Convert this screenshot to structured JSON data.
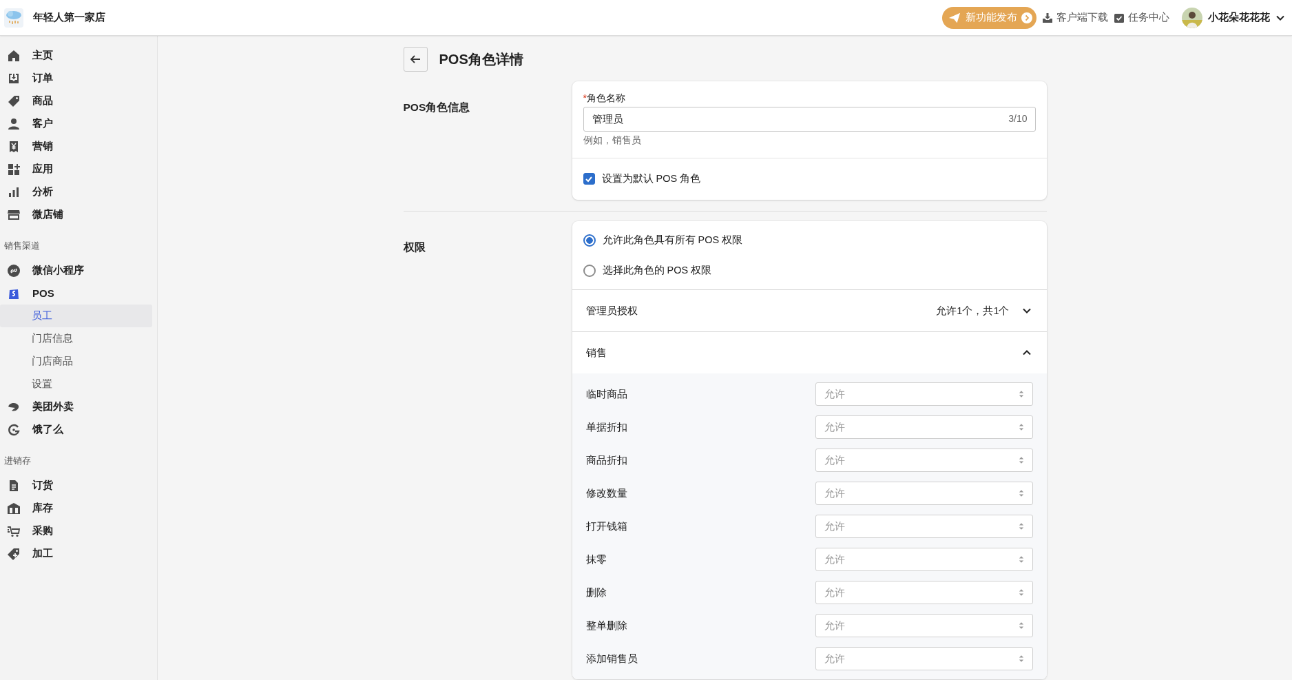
{
  "store": {
    "name": "年轻人第一家店"
  },
  "topbar": {
    "announce": "新功能发布",
    "links": [
      "客户端下载",
      "任务中心"
    ],
    "user": "小花朵花花花"
  },
  "sidebar": [
    {
      "items": [
        {
          "label": "主页",
          "selected": false
        },
        {
          "label": "订单",
          "selected": false
        },
        {
          "label": "商品",
          "selected": false
        },
        {
          "label": "客户",
          "selected": false
        },
        {
          "label": "营销",
          "selected": false
        },
        {
          "label": "应用",
          "selected": false
        },
        {
          "label": "分析",
          "selected": false
        },
        {
          "label": "微店铺",
          "selected": false
        }
      ]
    },
    {
      "heading": "销售渠道",
      "items": [
        {
          "label": "微信小程序",
          "selected": false
        },
        {
          "label": "POS",
          "selected": false,
          "children": [
            {
              "label": "员工",
              "selected": true
            },
            {
              "label": "门店信息",
              "selected": false
            },
            {
              "label": "门店商品",
              "selected": false
            },
            {
              "label": "设置",
              "selected": false
            }
          ]
        },
        {
          "label": "美团外卖",
          "selected": false
        },
        {
          "label": "饿了么",
          "selected": false
        }
      ]
    },
    {
      "heading": "进销存",
      "items": [
        {
          "label": "订货",
          "selected": false
        },
        {
          "label": "库存",
          "selected": false
        },
        {
          "label": "采购",
          "selected": false
        },
        {
          "label": "加工",
          "selected": false
        }
      ]
    }
  ],
  "page": {
    "title": "POS角色详情"
  },
  "info": {
    "title": "POS角色信息",
    "field": {
      "label": "角色名称",
      "required_mark": "*",
      "value": "管理员",
      "counter": "3/10",
      "help": "例如，销售员"
    },
    "checkbox": {
      "label": "设置为默认 POS 角色",
      "checked": true
    }
  },
  "permissions": {
    "title": "权限",
    "radios": [
      {
        "label": "允许此角色具有所有 POS 权限",
        "selected": true
      },
      {
        "label": "选择此角色的 POS 权限",
        "selected": false
      }
    ],
    "sections": [
      {
        "title": "管理员授权",
        "summary": "允许1个，共1个",
        "expanded": false
      },
      {
        "title": "销售",
        "expanded": true,
        "rows": [
          {
            "label": "临时商品",
            "placeholder": "允许"
          },
          {
            "label": "单据折扣",
            "placeholder": "允许"
          },
          {
            "label": "商品折扣",
            "placeholder": "允许"
          },
          {
            "label": "修改数量",
            "placeholder": "允许"
          },
          {
            "label": "打开钱箱",
            "placeholder": "允许"
          },
          {
            "label": "抹零",
            "placeholder": "允许"
          },
          {
            "label": "删除",
            "placeholder": "允许"
          },
          {
            "label": "整单删除",
            "placeholder": "允许"
          },
          {
            "label": "添加销售员",
            "placeholder": "允许"
          }
        ]
      }
    ]
  }
}
